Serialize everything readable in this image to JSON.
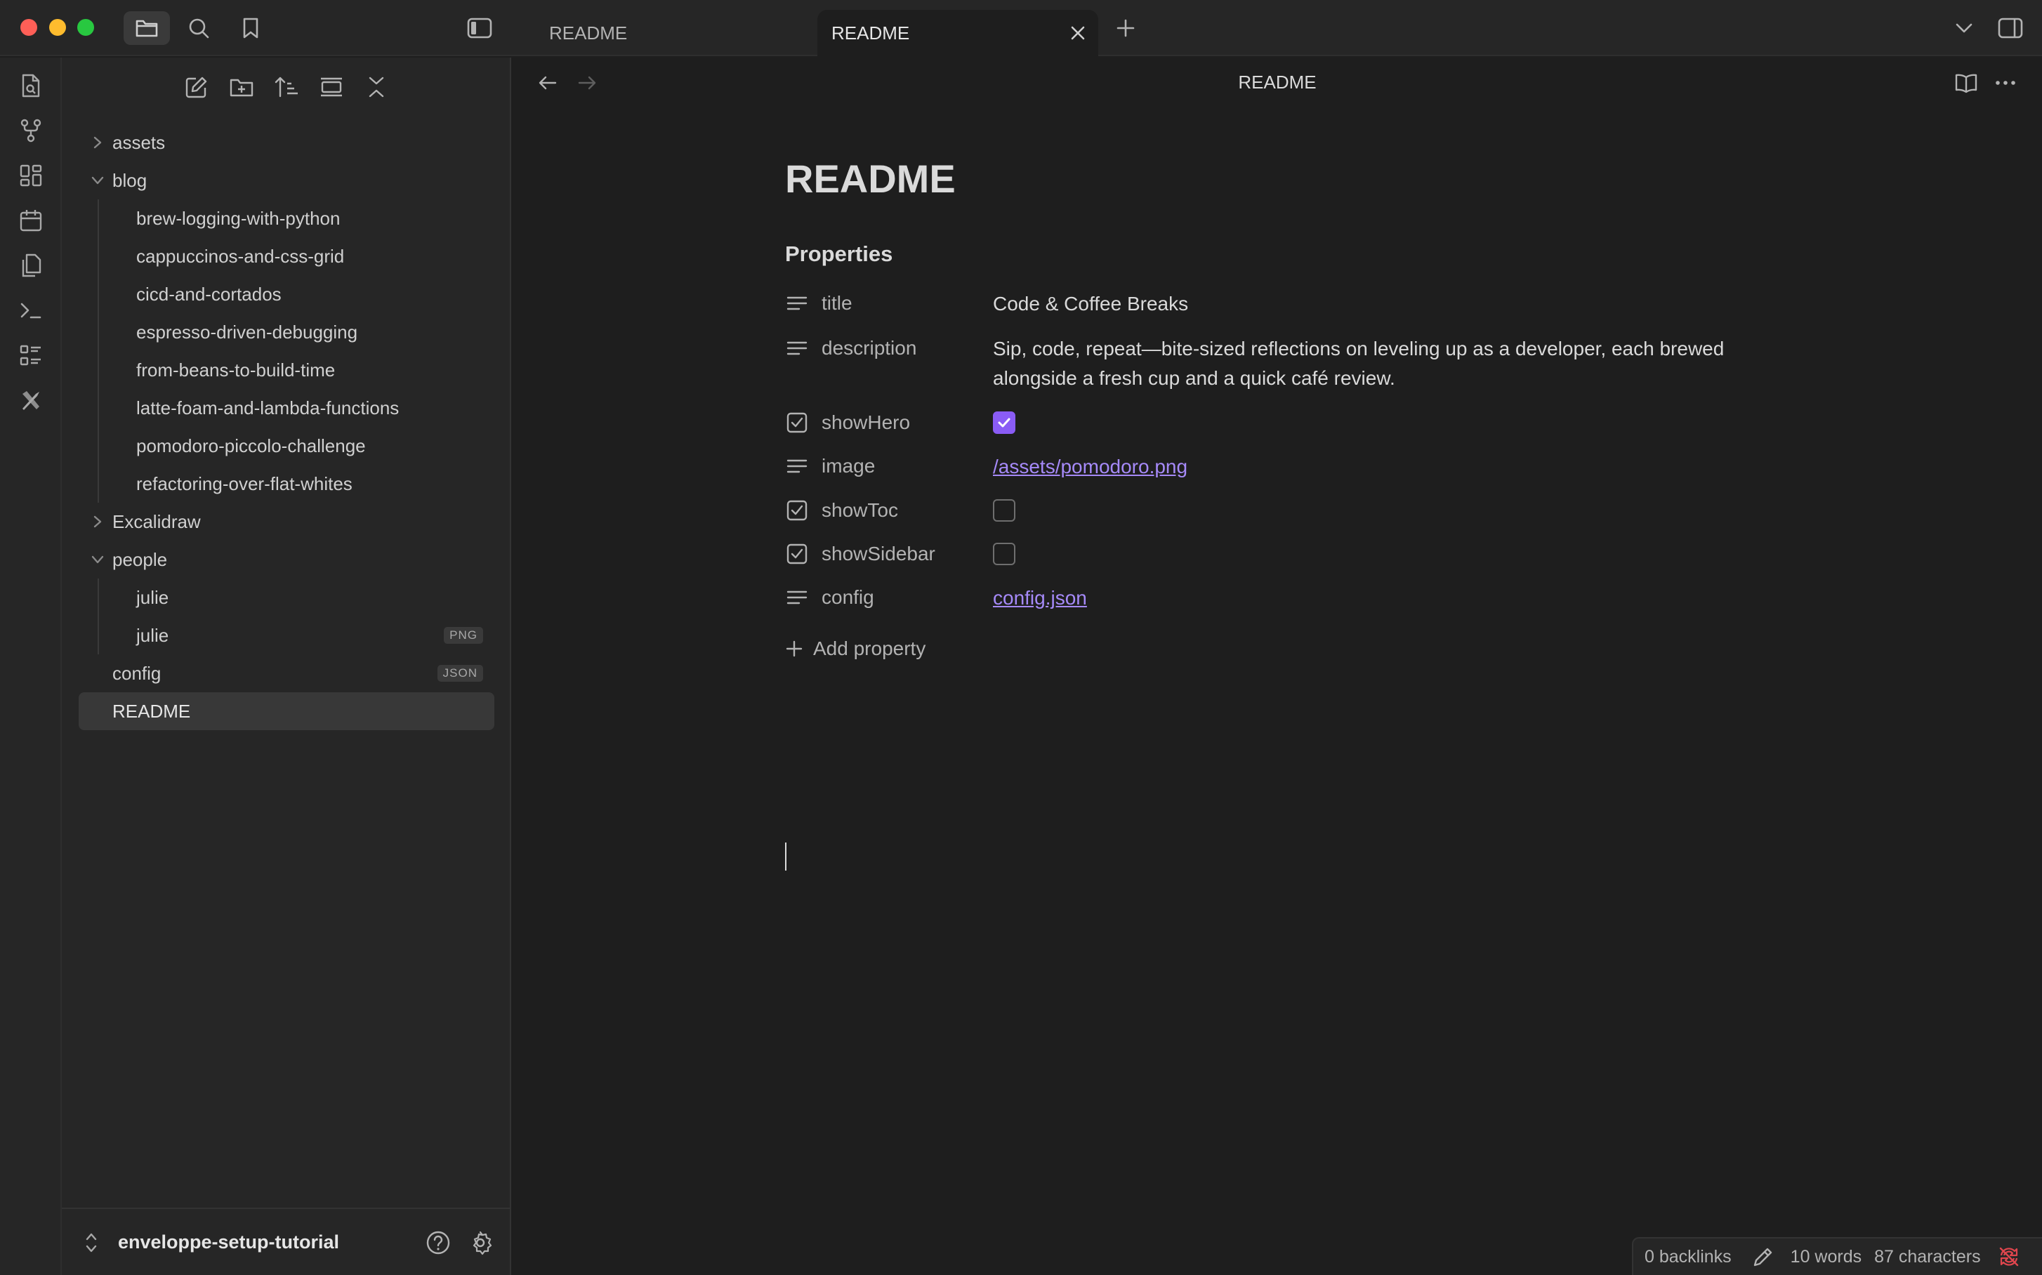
{
  "tabs": [
    {
      "label": "README",
      "active": false
    },
    {
      "label": "README",
      "active": true
    }
  ],
  "explorer": {
    "items": [
      {
        "label": "assets",
        "type": "folder",
        "expanded": false
      },
      {
        "label": "blog",
        "type": "folder",
        "expanded": true
      },
      {
        "label": "brew-logging-with-python",
        "type": "file"
      },
      {
        "label": "cappuccinos-and-css-grid",
        "type": "file"
      },
      {
        "label": "cicd-and-cortados",
        "type": "file"
      },
      {
        "label": "espresso-driven-debugging",
        "type": "file"
      },
      {
        "label": "from-beans-to-build-time",
        "type": "file"
      },
      {
        "label": "latte-foam-and-lambda-functions",
        "type": "file"
      },
      {
        "label": "pomodoro-piccolo-challenge",
        "type": "file"
      },
      {
        "label": "refactoring-over-flat-whites",
        "type": "file"
      },
      {
        "label": "Excalidraw",
        "type": "folder",
        "expanded": false
      },
      {
        "label": "people",
        "type": "folder",
        "expanded": true
      },
      {
        "label": "julie",
        "type": "file"
      },
      {
        "label": "julie",
        "type": "file",
        "badge": "PNG"
      },
      {
        "label": "config",
        "type": "file",
        "badge": "JSON"
      },
      {
        "label": "README",
        "type": "file",
        "selected": true
      }
    ]
  },
  "vault": {
    "name": "enveloppe-setup-tutorial"
  },
  "view": {
    "title": "README"
  },
  "note": {
    "title": "README",
    "properties_heading": "Properties",
    "properties": [
      {
        "key": "title",
        "icon": "text-icon",
        "value": "Code & Coffee Breaks"
      },
      {
        "key": "description",
        "icon": "text-icon",
        "value": "Sip, code, repeat—bite-sized reflections on leveling up as a developer, each brewed alongside a fresh cup and a quick café review."
      },
      {
        "key": "showHero",
        "icon": "checkbox-icon",
        "checked": true
      },
      {
        "key": "image",
        "icon": "text-icon",
        "value": "/assets/pomodoro.png"
      },
      {
        "key": "showToc",
        "icon": "checkbox-icon",
        "checked": false
      },
      {
        "key": "showSidebar",
        "icon": "checkbox-icon",
        "checked": false
      },
      {
        "key": "config",
        "icon": "text-icon",
        "value": "config.json"
      }
    ],
    "add_property_label": "Add property"
  },
  "status": {
    "backlinks": "0 backlinks",
    "words": "10 words",
    "characters": "87 characters"
  },
  "colors": {
    "accent": "#8a5cf5",
    "link": "#a68af9",
    "sync_error": "#e0464e"
  }
}
